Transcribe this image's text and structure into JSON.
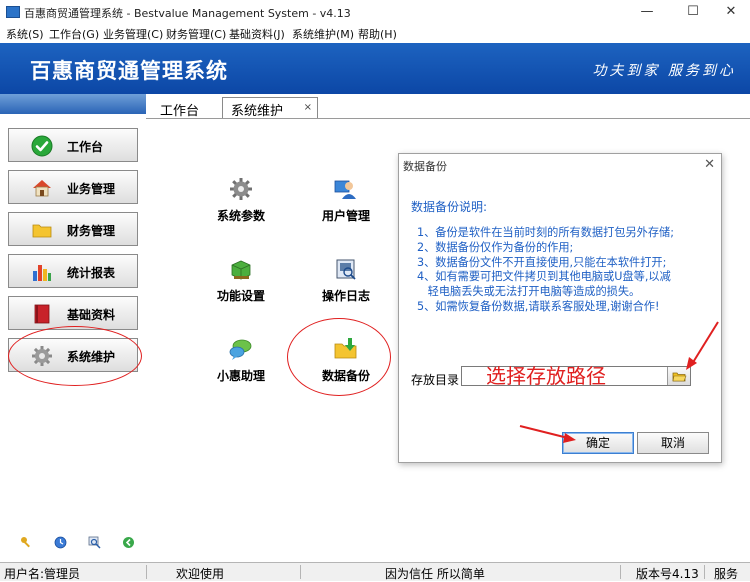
{
  "window": {
    "title": "百惠商贸通管理系统 - Bestvalue Management System - v4.13",
    "minimize": "—",
    "maximize": "☐",
    "close": "✕"
  },
  "menu": [
    {
      "label": "系统(S)"
    },
    {
      "label": "工作台(G)"
    },
    {
      "label": "业务管理(C)"
    },
    {
      "label": "财务管理(C)"
    },
    {
      "label": "基础资料(J)"
    },
    {
      "label": "系统维护(M)"
    },
    {
      "label": "帮助(H)"
    }
  ],
  "banner": {
    "title": "百惠商贸通管理系统",
    "slogan": "功夫到家 服务到心"
  },
  "sidebar": {
    "items": [
      {
        "label": "工作台",
        "icon": "check-circle-icon"
      },
      {
        "label": "业务管理",
        "icon": "house-icon"
      },
      {
        "label": "财务管理",
        "icon": "folder-icon"
      },
      {
        "label": "统计报表",
        "icon": "bar-chart-icon"
      },
      {
        "label": "基础资料",
        "icon": "book-icon"
      },
      {
        "label": "系统维护",
        "icon": "gear-icon"
      }
    ],
    "bottom_icons": [
      "key-icon",
      "clock-icon",
      "magnifier-icon",
      "green-arrow-icon"
    ]
  },
  "tabs": {
    "plain": "工作台",
    "active": "系统维护",
    "close": "×"
  },
  "functions": [
    {
      "label": "系统参数",
      "icon": "gear-icon"
    },
    {
      "label": "用户管理",
      "icon": "user-icon"
    },
    {
      "label": "功能设置",
      "icon": "green-box-icon"
    },
    {
      "label": "操作日志",
      "icon": "log-icon"
    },
    {
      "label": "小惠助理",
      "icon": "chat-bubble-icon"
    },
    {
      "label": "数据备份",
      "icon": "folder-download-icon"
    }
  ],
  "dialog": {
    "title": "数据备份",
    "close": "✕",
    "heading": "数据备份说明:",
    "notes": [
      "1、备份是软件在当前时刻的所有数据打包另外存储;",
      "2、数据备份仅作为备份的作用;",
      "3、数据备份文件不开直接使用,只能在本软件打开;",
      "4、如有需要可把文件拷贝到其他电脑或U盘等,以减",
      "   轻电脑丢失或无法打开电脑等造成的损失。",
      "5、如需恢复备份数据,请联系客服处理,谢谢合作!"
    ],
    "dir_label": "存放目录",
    "dir_value": "",
    "annotation": "选择存放路径",
    "ok": "确定",
    "cancel": "取消"
  },
  "status": {
    "user": "用户名:管理员",
    "welcome": "欢迎使用",
    "motto": "因为信任 所以简单",
    "version": "版本号4.13",
    "service": "服务"
  },
  "colors": {
    "banner_blue": "#0c47a6",
    "note_blue": "#1e5fc4",
    "annotation_red": "#e02020"
  }
}
